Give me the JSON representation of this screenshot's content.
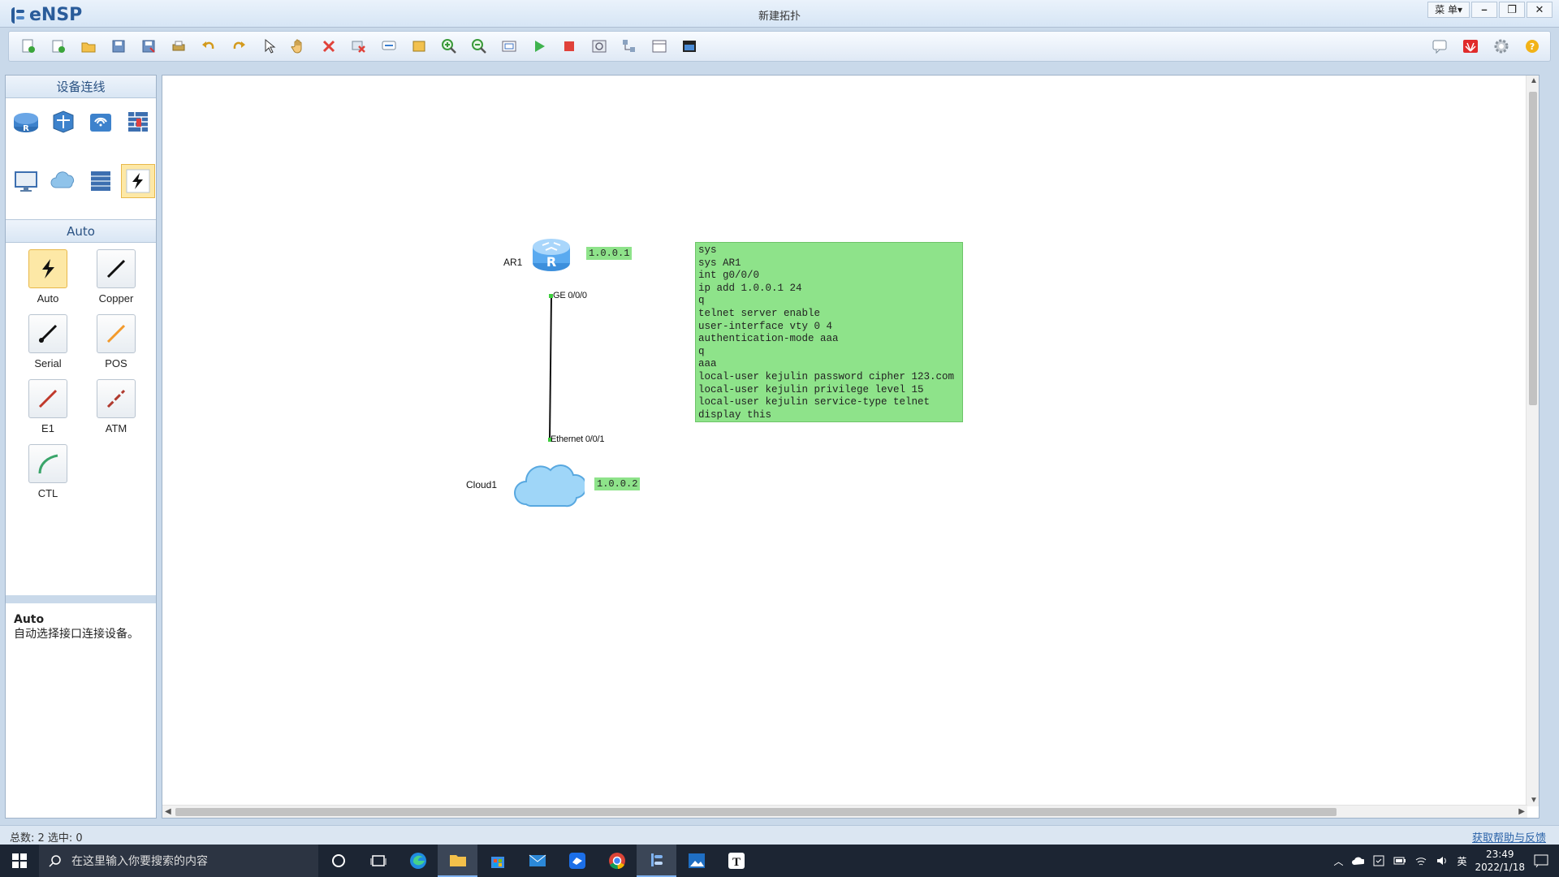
{
  "app": {
    "logo": "eNSP",
    "window_title": "新建拓扑",
    "menu_label": "菜 单▾"
  },
  "toolbar": {
    "buttons": [
      "new-topology",
      "new-experiment",
      "open",
      "save",
      "save-as",
      "print",
      "undo",
      "redo",
      "select",
      "pan",
      "delete",
      "delete-connection",
      "add-text",
      "add-shape",
      "zoom-in",
      "zoom-out",
      "fit",
      "start-device",
      "stop-device",
      "capture",
      "show-grid",
      "topology-manager",
      "capture-screen"
    ],
    "right_buttons": [
      "forum",
      "huawei-site",
      "settings",
      "help"
    ]
  },
  "left_panel": {
    "device_header": "设备连线",
    "devices": [
      "router",
      "switch",
      "wireless",
      "firewall",
      "terminal",
      "cloud",
      "other-device",
      "auto-connection"
    ],
    "link_header": "Auto",
    "links": [
      {
        "label": "Auto",
        "color": "#111111"
      },
      {
        "label": "Copper",
        "color": "#111111"
      },
      {
        "label": "Serial",
        "color": "#111111"
      },
      {
        "label": "POS",
        "color": "#f39a2b"
      },
      {
        "label": "E1",
        "color": "#c0392b"
      },
      {
        "label": "ATM",
        "color": "#b03a2e"
      },
      {
        "label": "CTL",
        "color": "#3aa56a"
      }
    ],
    "description": {
      "title": "Auto",
      "text": "自动选择接口连接设备。"
    }
  },
  "topology": {
    "router": {
      "name": "AR1",
      "ip": "1.0.0.1",
      "port": "GE 0/0/0"
    },
    "cloud": {
      "name": "Cloud1",
      "ip": "1.0.0.2",
      "port": "Ethernet 0/0/1"
    },
    "note_lines": [
      "sys",
      "sys AR1",
      "int g0/0/0",
      "ip add 1.0.0.1 24",
      "q",
      "telnet server enable",
      "user-interface vty 0 4",
      "authentication-mode aaa",
      "q",
      "aaa",
      "local-user kejulin password cipher 123.com",
      "local-user kejulin privilege level 15",
      "local-user kejulin service-type telnet",
      "display this"
    ]
  },
  "statusbar": {
    "left": "总数: 2 选中: 0",
    "right": "获取帮助与反馈"
  },
  "taskbar": {
    "search_placeholder": "在这里输入你要搜索的内容",
    "apps": [
      "cortana",
      "task-view",
      "edge",
      "file-explorer",
      "store",
      "mail",
      "feishu",
      "chrome",
      "ensp",
      "photos",
      "typora"
    ],
    "ime": "英",
    "time": "23:49",
    "date": "2022/1/18"
  }
}
